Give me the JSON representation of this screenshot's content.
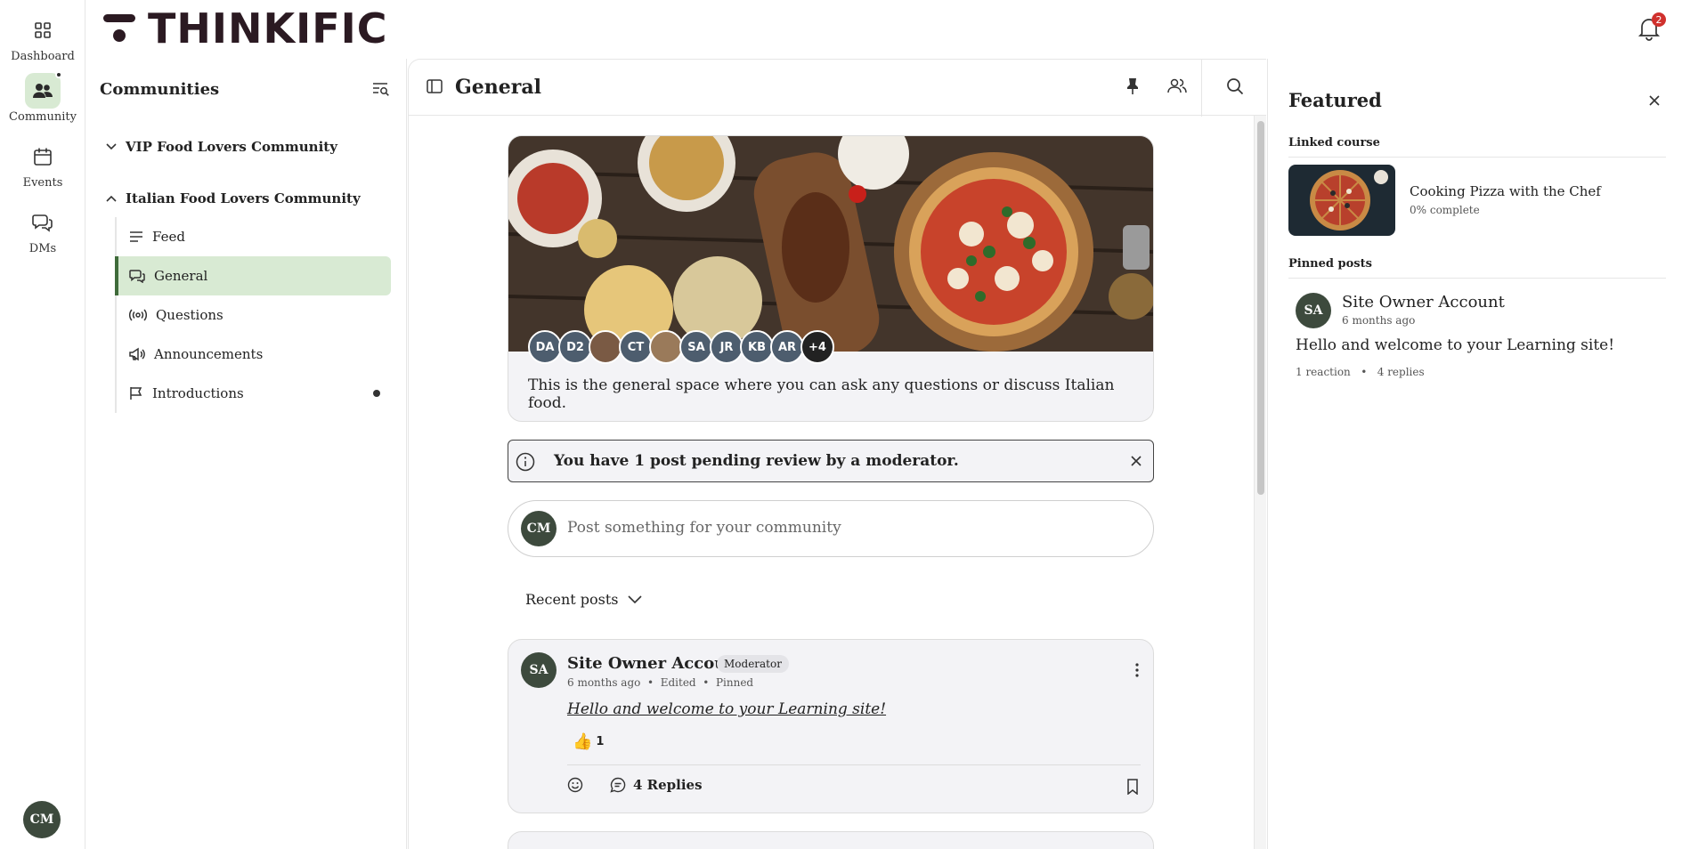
{
  "rail": {
    "items": [
      {
        "label": "Dashboard",
        "icon": "grid-icon"
      },
      {
        "label": "Community",
        "icon": "people-icon"
      },
      {
        "label": "Events",
        "icon": "calendar-icon"
      },
      {
        "label": "DMs",
        "icon": "chat-icon"
      }
    ],
    "user_initials": "CM"
  },
  "brand": {
    "name": "THINKIFIC"
  },
  "notifications": {
    "count": "2"
  },
  "communities": {
    "title": "Communities",
    "groups": [
      {
        "name": "VIP Food Lovers Community",
        "expanded": false
      },
      {
        "name": "Italian Food Lovers Community",
        "expanded": true
      }
    ],
    "spaces": [
      {
        "label": "Feed",
        "icon": "lines-icon"
      },
      {
        "label": "General",
        "icon": "chat-bubbles-icon",
        "active": true
      },
      {
        "label": "Questions",
        "icon": "broadcast-icon"
      },
      {
        "label": "Announcements",
        "icon": "megaphone-icon"
      },
      {
        "label": "Introductions",
        "icon": "flag-icon",
        "unread": true
      }
    ]
  },
  "main": {
    "title": "General",
    "banner": {
      "description": "This is the general space where you can ask any questions or discuss Italian food.",
      "members": [
        "DA",
        "D2",
        "",
        "CT",
        "",
        "SA",
        "JR",
        "KB",
        "AR"
      ],
      "more": "+4"
    },
    "notice": "You have 1 post pending review by a moderator.",
    "composer": {
      "avatar": "CM",
      "placeholder": "Post something for your community"
    },
    "sort_label": "Recent posts",
    "post": {
      "avatar": "SA",
      "author": "Site Owner Account",
      "role": "Moderator",
      "time": "6 months ago",
      "edited": "Edited",
      "pinned": "Pinned",
      "body": "Hello and welcome to your Learning site!",
      "reaction_emoji": "👍",
      "reaction_count": "1",
      "replies_label": "4 Replies"
    }
  },
  "featured": {
    "title": "Featured",
    "linked_course_label": "Linked course",
    "course": {
      "name": "Cooking Pizza with the Chef",
      "progress": "0% complete"
    },
    "pinned_label": "Pinned posts",
    "pinned": {
      "avatar": "SA",
      "author": "Site Owner Account",
      "time": "6 months ago",
      "body": "Hello and welcome to your Learning site!",
      "reactions": "1 reaction",
      "replies": "4 replies"
    }
  },
  "colors": {
    "accent": "#d8ead3",
    "accent_border": "#3f6b3a",
    "brand": "#2b1a22",
    "badge": "#d0312d"
  }
}
